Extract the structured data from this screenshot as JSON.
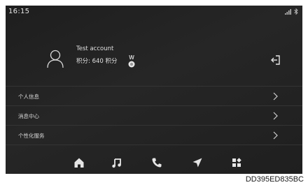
{
  "status": {
    "time": "16:15",
    "icons": [
      "signal-icon",
      "bluetooth-icon"
    ]
  },
  "profile": {
    "account_name": "Test account",
    "points": "积分: 640 积分",
    "medal_letter": "W",
    "icons": [
      "user-avatar-icon",
      "medal-icon",
      "logout-icon"
    ]
  },
  "menu": {
    "items": [
      {
        "label": "个人信息"
      },
      {
        "label": "消息中心"
      },
      {
        "label": "个性化服务"
      }
    ]
  },
  "dock": {
    "icons": [
      "home-icon",
      "music-icon",
      "phone-icon",
      "navigation-icon",
      "apps-icon"
    ]
  },
  "watermark": "DD395ED835BC",
  "colors": {
    "background": "#222222",
    "text": "#e0e0e0",
    "divider": "#343434"
  }
}
